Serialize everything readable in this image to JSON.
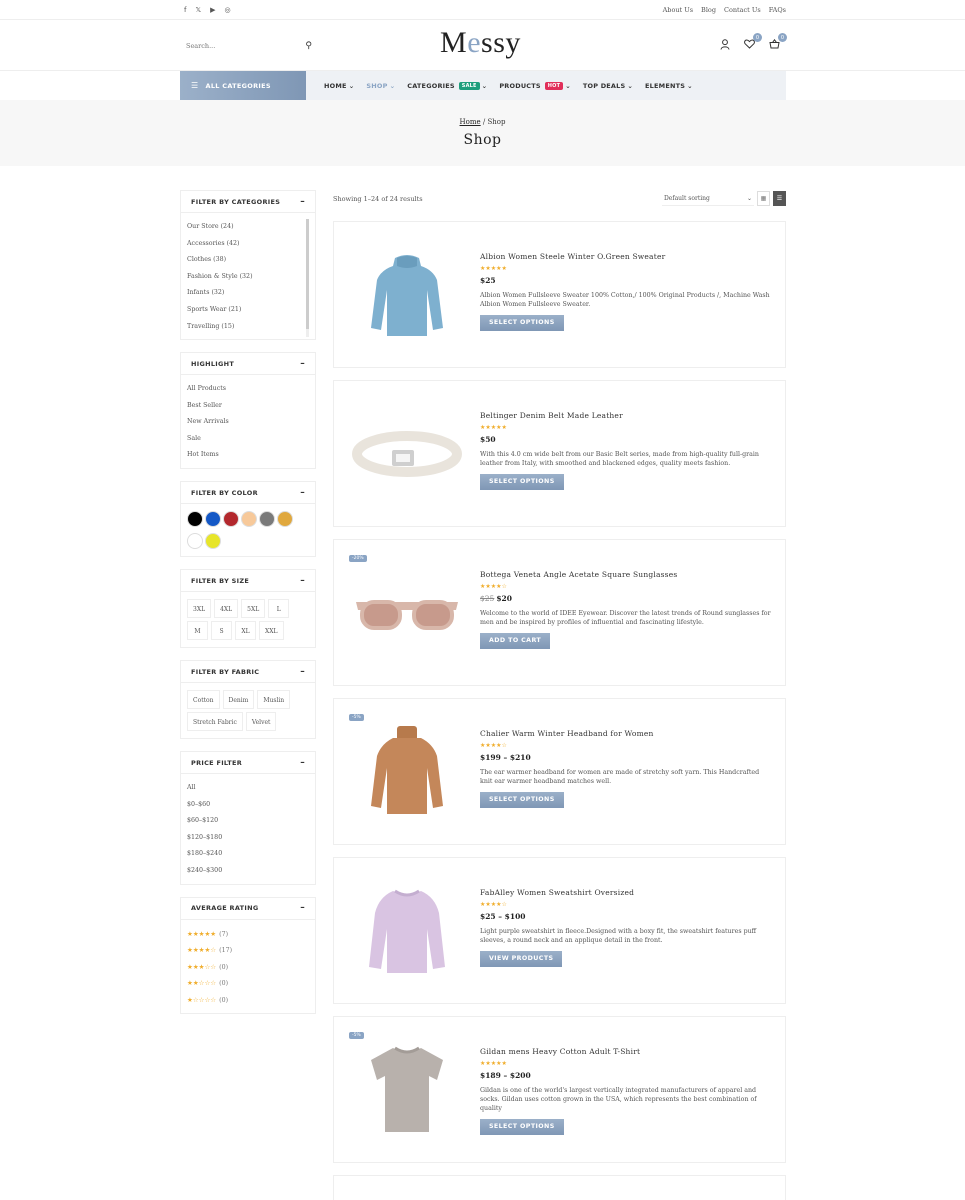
{
  "topbar": {
    "social": [
      "f",
      "𝕏",
      "▶",
      "◎"
    ],
    "links": [
      "About Us",
      "Blog",
      "Contact Us",
      "FAQs"
    ]
  },
  "header": {
    "search_placeholder": "Search...",
    "logo_m": "M",
    "logo_e": "e",
    "logo_rest": "ssy",
    "wishlist_count": "0",
    "cart_count": "0"
  },
  "nav": {
    "all_categories": "ALL CATEGORIES",
    "items": [
      {
        "label": "HOME",
        "tag": ""
      },
      {
        "label": "SHOP",
        "tag": ""
      },
      {
        "label": "CATEGORIES",
        "tag": "SALE"
      },
      {
        "label": "PRODUCTS",
        "tag": "HOT"
      },
      {
        "label": "TOP DEALS",
        "tag": ""
      },
      {
        "label": "ELEMENTS",
        "tag": ""
      }
    ]
  },
  "breadcrumb": {
    "home": "Home",
    "sep": " / ",
    "current": "Shop",
    "title": "Shop"
  },
  "sidebar": {
    "categories_title": "FILTER BY CATEGORIES",
    "categories": [
      "Our Store (24)",
      "Accessories (42)",
      "Clothes (38)",
      "Fashion & Style (32)",
      "Infants (32)",
      "Sports Wear (21)",
      "Travelling (15)"
    ],
    "highlight_title": "HIGHLIGHT",
    "highlight": [
      "All Products",
      "Best Seller",
      "New Arrivals",
      "Sale",
      "Hot Items"
    ],
    "color_title": "FILTER BY COLOR",
    "colors": [
      "#000000",
      "#1458c6",
      "#b3282d",
      "#f7c99a",
      "#7a7a7a",
      "#e0a83e",
      "#ffffff",
      "#e7e52a"
    ],
    "size_title": "FILTER BY SIZE",
    "sizes": [
      "3XL",
      "4XL",
      "5XL",
      "L",
      "M",
      "S",
      "XL",
      "XXL"
    ],
    "fabric_title": "FILTER BY FABRIC",
    "fabrics": [
      "Cotton",
      "Denim",
      "Muslin",
      "Stretch Fabric",
      "Velvet"
    ],
    "price_title": "PRICE FILTER",
    "prices": [
      "All",
      "$0–$60",
      "$60–$120",
      "$120–$180",
      "$180–$240",
      "$240–$300"
    ],
    "rating_title": "AVERAGE RATING",
    "ratings": [
      {
        "stars": "★★★★★",
        "count": "(7)"
      },
      {
        "stars": "★★★★☆",
        "count": "(17)"
      },
      {
        "stars": "★★★☆☆",
        "count": "(0)"
      },
      {
        "stars": "★★☆☆☆",
        "count": "(0)"
      },
      {
        "stars": "★☆☆☆☆",
        "count": "(0)"
      }
    ]
  },
  "toolbar": {
    "results": "Showing 1–24 of 24 results",
    "sort": "Default sorting"
  },
  "products": [
    {
      "name": "Albion Women Steele Winter O.Green Sweater",
      "stars": "★★★★★",
      "old": "",
      "price": "$25",
      "desc": "Albion Women Fullsleeve Sweater 100% Cotton,/ 100% Original Products /, Machine Wash Albion Women Fullsleeve Sweater.",
      "button": "SELECT OPTIONS",
      "badge": "",
      "image": "sweater-blue"
    },
    {
      "name": "Beltinger Denim Belt Made Leather",
      "stars": "★★★★★",
      "old": "",
      "price": "$50",
      "desc": "With this 4.0 cm wide belt from our Basic Belt series, made from high-quality full-grain leather from Italy, with smoothed and blackened edges, quality meets fashion.",
      "button": "SELECT OPTIONS",
      "badge": "",
      "image": "belt"
    },
    {
      "name": "Bottega Veneta Angle Acetate Square Sunglasses",
      "stars": "★★★★☆",
      "old": "$25",
      "price": "$20",
      "desc": "Welcome to the world of IDEE Eyewear. Discover the latest trends of Round sunglasses for men and be inspired by profiles of influential and fascinating lifestyle.",
      "button": "ADD TO CART",
      "badge": "-20%",
      "image": "sunglasses"
    },
    {
      "name": "Chalier Warm Winter Headband for Women",
      "stars": "★★★★☆",
      "old": "",
      "price": "$199 – $210",
      "desc": "The ear warmer headband for women are made of stretchy soft yarn. This Handcrafted knit ear warmer headband matches well.",
      "button": "SELECT OPTIONS",
      "badge": "-5%",
      "image": "sweater-brown"
    },
    {
      "name": "FabAlley Women Sweatshirt Oversized",
      "stars": "★★★★☆",
      "old": "",
      "price": "$25 – $100",
      "desc": "Light purple sweatshirt in fleece.Designed with a boxy fit, the sweatshirt features puff sleeves, a round neck and an applique detail in the front.",
      "button": "VIEW PRODUCTS",
      "badge": "",
      "image": "sweatshirt-lilac"
    },
    {
      "name": "Gildan mens Heavy Cotton Adult T-Shirt",
      "stars": "★★★★★",
      "old": "",
      "price": "$189 – $200",
      "desc": "Gildan is one of the world's largest vertically integrated manufacturers of apparel and socks. Gildan uses cotton grown in the USA, which represents the best combination of quality",
      "button": "SELECT OPTIONS",
      "badge": "-5%",
      "image": "tshirt-grey"
    }
  ]
}
